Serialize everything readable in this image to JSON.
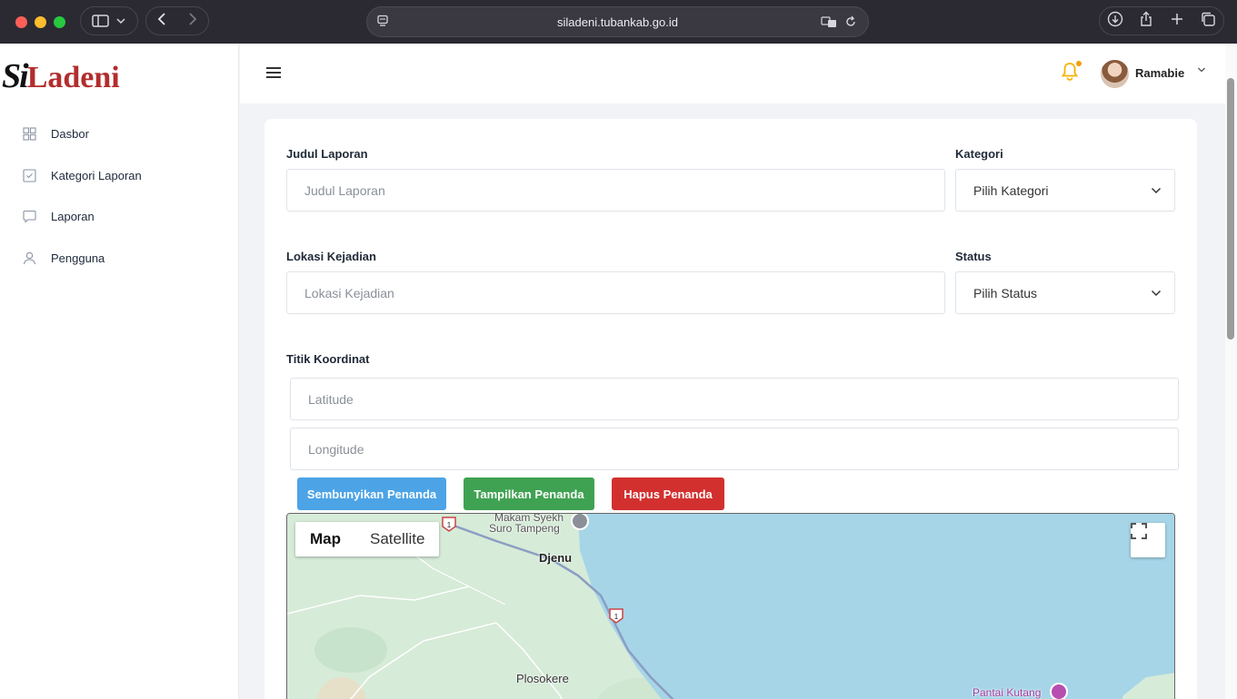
{
  "browser": {
    "url": "siladeni.tubankab.go.id"
  },
  "brand": {
    "prefix": "Si",
    "name": "Ladeni",
    "color": "#b32d2d"
  },
  "sidebar": {
    "items": [
      {
        "label": "Dasbor",
        "icon": "grid-icon"
      },
      {
        "label": "Kategori Laporan",
        "icon": "checkbox-icon"
      },
      {
        "label": "Laporan",
        "icon": "message-icon"
      },
      {
        "label": "Pengguna",
        "icon": "user-icon"
      }
    ]
  },
  "topbar": {
    "username": "Ramabie"
  },
  "form": {
    "judul_label": "Judul Laporan",
    "judul_placeholder": "Judul Laporan",
    "kategori_label": "Kategori",
    "kategori_value": "Pilih Kategori",
    "lokasi_label": "Lokasi Kejadian",
    "lokasi_placeholder": "Lokasi Kejadian",
    "status_label": "Status",
    "status_value": "Pilih Status",
    "koordinat_label": "Titik Koordinat",
    "latitude_placeholder": "Latitude",
    "longitude_placeholder": "Longitude"
  },
  "buttons": {
    "hide_marker": "Sembunyikan Penanda",
    "show_marker": "Tampilkan Penanda",
    "delete_marker": "Hapus Penanda"
  },
  "map": {
    "type_map": "Map",
    "type_satellite": "Satellite",
    "labels": {
      "makam_line1": "Makam Syekh",
      "makam_line2": "Suro Tampeng",
      "djenu": "Djenu",
      "plosokere": "Plosokere",
      "pantai": "Pantai Kutang",
      "road_number": "1"
    }
  },
  "colors": {
    "blue_button": "#4ca4e6",
    "green_button": "#3fa252",
    "red_button": "#d2302f",
    "bell": "#f5b301"
  }
}
